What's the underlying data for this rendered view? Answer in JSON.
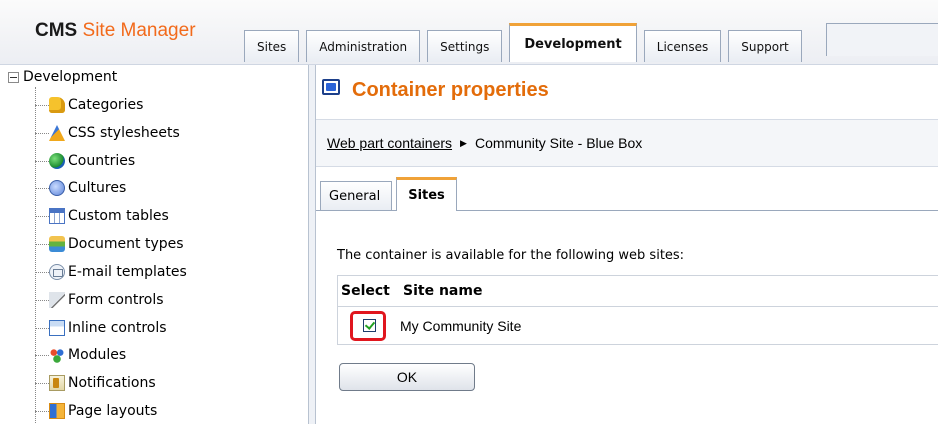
{
  "header": {
    "brand_bold": "CMS",
    "brand_rest": "Site Manager",
    "tabs": [
      {
        "label": "Sites",
        "active": false
      },
      {
        "label": "Administration",
        "active": false
      },
      {
        "label": "Settings",
        "active": false
      },
      {
        "label": "Development",
        "active": true
      },
      {
        "label": "Licenses",
        "active": false
      },
      {
        "label": "Support",
        "active": false
      }
    ]
  },
  "tree": {
    "root": "Development",
    "items": [
      {
        "label": "Categories",
        "icon": "categories-icon"
      },
      {
        "label": "CSS stylesheets",
        "icon": "css-icon"
      },
      {
        "label": "Countries",
        "icon": "countries-icon"
      },
      {
        "label": "Cultures",
        "icon": "cultures-icon"
      },
      {
        "label": "Custom tables",
        "icon": "custom-tables-icon"
      },
      {
        "label": "Document types",
        "icon": "document-types-icon"
      },
      {
        "label": "E-mail templates",
        "icon": "email-templates-icon"
      },
      {
        "label": "Form controls",
        "icon": "form-controls-icon"
      },
      {
        "label": "Inline controls",
        "icon": "inline-controls-icon"
      },
      {
        "label": "Modules",
        "icon": "modules-icon"
      },
      {
        "label": "Notifications",
        "icon": "notifications-icon"
      },
      {
        "label": "Page layouts",
        "icon": "page-layouts-icon"
      }
    ]
  },
  "content": {
    "title": "Container properties",
    "breadcrumb_link": "Web part containers",
    "breadcrumb_current": "Community Site - Blue Box",
    "tabs": [
      {
        "label": "General",
        "active": false
      },
      {
        "label": "Sites",
        "active": true
      }
    ],
    "description": "The container is available for the following web sites:",
    "grid": {
      "headers": [
        "Select",
        "Site name"
      ],
      "rows": [
        {
          "selected": true,
          "site_name": "My Community Site"
        }
      ]
    },
    "ok_label": "OK"
  },
  "colors": {
    "accent_orange": "#e36c0a",
    "tab_highlight": "#f0a238",
    "annotation_red": "#e0161e",
    "check_green": "#21a121"
  }
}
